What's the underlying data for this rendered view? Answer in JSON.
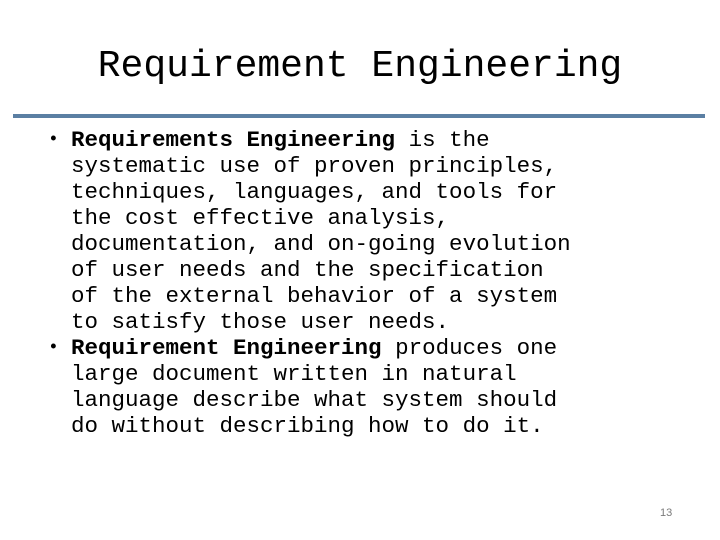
{
  "slide": {
    "title": "Requirement Engineering",
    "bullets": [
      {
        "bold": "Requirements Engineering",
        "lines": [
          " is the",
          "systematic use of proven principles,",
          "techniques, languages, and tools for",
          "the cost effective analysis,",
          "documentation, and on-going evolution",
          "of user needs and the specification",
          "of the external behavior of a system",
          "to satisfy those user needs."
        ]
      },
      {
        "bold": "Requirement Engineering",
        "lines": [
          " produces one",
          "large document written in natural",
          "language describe what system should",
          "do without describing how to do it."
        ]
      }
    ],
    "bullet_glyph": "•",
    "page_number": "13",
    "rule_color": "#5b7fa3"
  }
}
